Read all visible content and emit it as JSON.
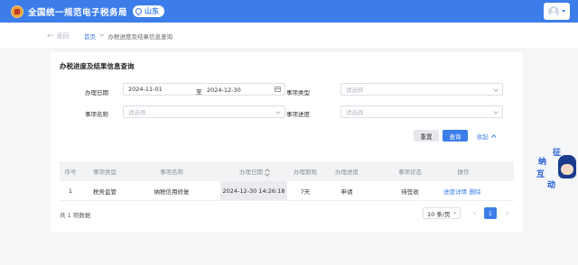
{
  "header": {
    "app_title": "全国统一规范电子税务局",
    "region": "山东"
  },
  "breadcrumb": {
    "back_label": "返回",
    "home": "首页",
    "separator": ">",
    "current": "办税进度及结果信息查询"
  },
  "form": {
    "title": "办税进度及结果信息查询",
    "date_label": "办理日期",
    "date_start": "2024-11-01",
    "date_to": "至",
    "date_end": "2024-12-30",
    "type_label": "事项类型",
    "type_placeholder": "请选择",
    "name_label": "事项名称",
    "name_placeholder": "请选择",
    "progress_label": "事项进度",
    "progress_placeholder": "请选择",
    "reset_label": "重置",
    "query_label": "查询",
    "collapse_label": "收起"
  },
  "table": {
    "columns": [
      "序号",
      "事项类型",
      "事项名称",
      "办理日期",
      "办理期限",
      "办理进度",
      "事项状态",
      "操作"
    ],
    "rows": [
      {
        "index": "1",
        "type": "税务监管",
        "name": "纳税信用修复",
        "date": "2024-12-30 14:26:18",
        "period": "7天",
        "progress": "申请",
        "status": "待签收",
        "action_detail": "进度详情",
        "action_delete": "删除"
      }
    ]
  },
  "pagination": {
    "total_text": "共 1 项数据",
    "page_size": "10 条/页",
    "current_page": "1"
  },
  "mascot": {
    "chars": [
      "征",
      "纳",
      "互",
      "动"
    ]
  },
  "colors": {
    "primary": "#3d7dea",
    "logo": "#e9a13a"
  }
}
